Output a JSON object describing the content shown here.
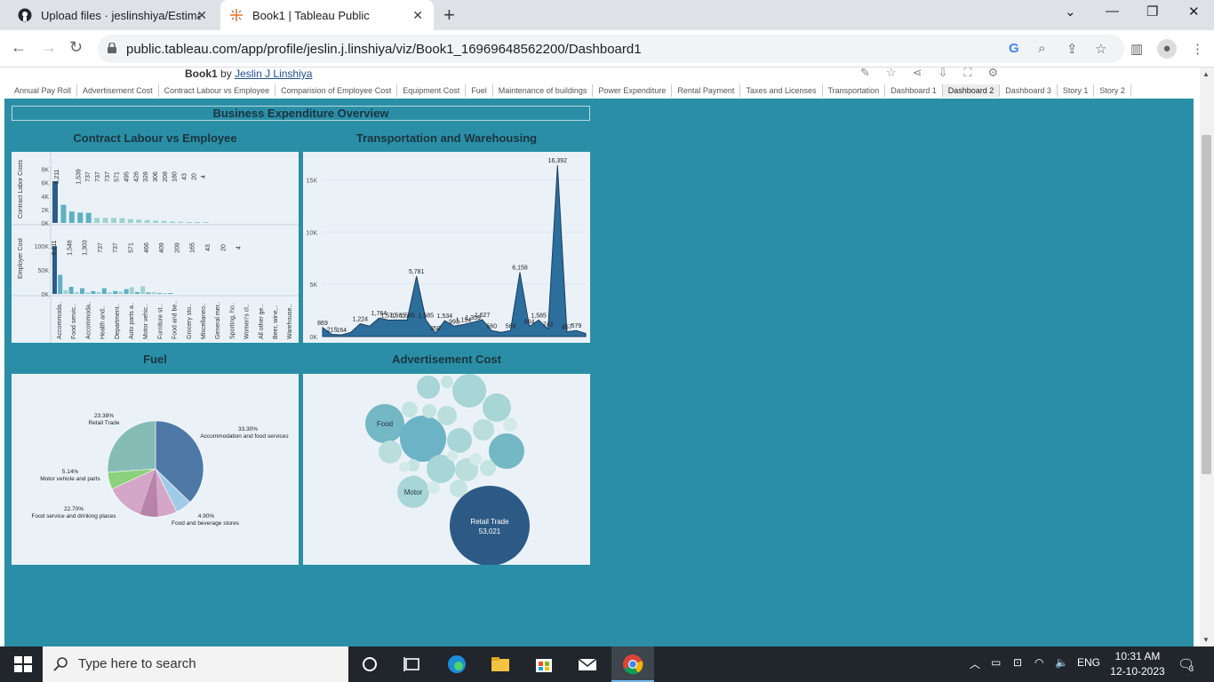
{
  "browser": {
    "tabs": [
      {
        "title": "Upload files · jeslinshiya/Estimat",
        "active": false
      },
      {
        "title": "Book1 | Tableau Public",
        "active": true
      }
    ],
    "url": "public.tableau.com/app/profile/jeslin.j.linshiya/viz/Book1_16969648562200/Dashboard1"
  },
  "viz_header": {
    "title": "Book1",
    "by": "by",
    "author": "Jeslin J Linshiya"
  },
  "sheet_tabs": [
    "Annual Pay Roll",
    "Advertisement Cost",
    "Contract Labour vs Employee",
    "Comparision of Employee Cost",
    "Equipment Cost",
    "Fuel",
    "Maintenance of buildings",
    "Power Expenditure",
    "Rental Payment",
    "Taxes and Licenses",
    "Transportation",
    "Dashboard 1",
    "Dashboard 2",
    "Dashboard 3",
    "Story 1",
    "Story 2"
  ],
  "selected_sheet": "Dashboard 2",
  "dashboard": {
    "title": "Business Expenditure Overview",
    "contract": {
      "title": "Contract Labour vs Employee",
      "top_axis_label": "Contract Labor Costs",
      "bottom_axis_label": "Employer Cost",
      "top_ticks": [
        "8K",
        "6K",
        "4K",
        "2K",
        "0K"
      ],
      "bottom_ticks": [
        "100K",
        "50K",
        "0K"
      ],
      "top_labels": [
        "6,211",
        "1,539",
        "737",
        "737",
        "737",
        "571",
        "495",
        "426",
        "328",
        "306",
        "208",
        "180",
        "43",
        "20",
        "4"
      ],
      "bottom_labels": [
        "6,211",
        "1,546",
        "1,303",
        "737",
        "737",
        "571",
        "466",
        "409",
        "209",
        "165",
        "43",
        "20",
        "4"
      ],
      "categories": [
        "Accommoda..",
        "Food servic..",
        "Accommoda..",
        "Health and..",
        "Department..",
        "Auto parts a..",
        "Motor vehic..",
        "Furniture st..",
        "Food and be..",
        "Grocery sto..",
        "Miscellaneo..",
        "General mer..",
        "Sporting, ho..",
        "Women's cl..",
        "All other ge..",
        "Beer, wine,..",
        "Warehouse.."
      ]
    },
    "transport": {
      "title": "Transportation and Warehousing",
      "ticks": [
        "15K",
        "10K",
        "5K",
        "0K"
      ],
      "point_labels": [
        "869",
        "215",
        "164",
        "1,224",
        "1,764",
        "1,570",
        "1,585",
        "1,585",
        "5,781",
        "1,585",
        "350",
        "1,534",
        "993",
        "1,154",
        "1,359",
        "1,627",
        "560",
        "569",
        "6,158",
        "964",
        "1,585",
        "742",
        "16,392",
        "457",
        "579"
      ]
    },
    "fuel": {
      "title": "Fuel",
      "slices": [
        {
          "label": "33.30%",
          "name": "Accommodation and food services",
          "color": "#4e79a7"
        },
        {
          "label": "4.90%",
          "name": "Food and beverage stores",
          "color": "#a0cbe8"
        },
        {
          "label": "22.70%",
          "name": "Food service and drinking places",
          "color": "#d4a6c8"
        },
        {
          "label": "5.14%",
          "name": "Motor vehicle and parts",
          "color": "#8cd17d"
        },
        {
          "label": "23.38%",
          "name": "Retail Trade",
          "color": "#86bcb6"
        }
      ]
    },
    "advert": {
      "title": "Advertisement Cost",
      "labels": {
        "food": "Food",
        "motor": "Motor",
        "retail": "Retail Trade",
        "retail_value": "53,021"
      }
    }
  },
  "taskbar": {
    "search_placeholder": "Type here to search",
    "lang": "ENG",
    "time": "10:31 AM",
    "date": "12-10-2023",
    "notif": "3"
  },
  "chart_data": [
    {
      "type": "bar",
      "title": "Contract Labour vs Employee",
      "ylabel": "Contract Labor Costs",
      "categories": [
        "Accommoda..",
        "Food servic..",
        "Accommoda..",
        "Health and..",
        "Department..",
        "Auto parts a..",
        "Motor vehic..",
        "Furniture st..",
        "Food and be..",
        "Grocery sto..",
        "Miscellaneo..",
        "General mer..",
        "Sporting, ho..",
        "Women's cl..",
        "All other ge..",
        "Beer, wine,..",
        "Warehouse.."
      ],
      "values": [
        6211,
        2700,
        1700,
        1539,
        1500,
        737,
        737,
        737,
        700,
        571,
        495,
        426,
        328,
        306,
        208,
        180,
        43,
        20,
        4
      ],
      "ylim": [
        0,
        9000
      ]
    },
    {
      "type": "bar",
      "ylabel": "Employer Cost",
      "values": [
        100000,
        40000,
        8000,
        15000,
        4000,
        12000,
        3000,
        6000,
        4000,
        12000,
        3000,
        6000,
        5000,
        10000,
        14000,
        4000,
        16000,
        3000,
        4000,
        2000,
        1500,
        1000
      ],
      "ylim": [
        0,
        130000
      ]
    },
    {
      "type": "area",
      "title": "Transportation and Warehousing",
      "values": [
        869,
        215,
        164,
        400,
        1224,
        1000,
        1764,
        1570,
        1585,
        1585,
        5781,
        1585,
        350,
        1534,
        993,
        1154,
        1359,
        1627,
        560,
        400,
        569,
        6158,
        964,
        1585,
        742,
        16392,
        457,
        579,
        300
      ],
      "ylim": [
        0,
        17000
      ]
    },
    {
      "type": "pie",
      "title": "Fuel",
      "values": [
        33.3,
        4.9,
        22.7,
        5.14,
        23.38
      ],
      "labels": [
        "Accommodation and food services",
        "Food and beverage stores",
        "Food service and drinking places",
        "Motor vehicle and parts",
        "Retail Trade"
      ]
    }
  ]
}
